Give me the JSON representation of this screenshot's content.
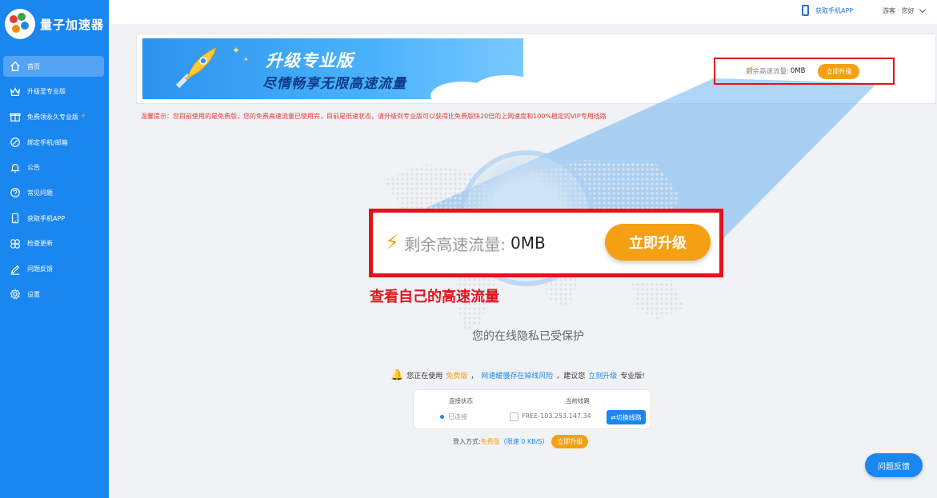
{
  "app": {
    "name": "量子加速器"
  },
  "colors": {
    "sidebar": "#1a86f0",
    "accent_orange": "#f5a012",
    "highlight_red": "#e5121b"
  },
  "sidebar": {
    "items": [
      {
        "label": "首页",
        "icon": "home-icon",
        "active": true
      },
      {
        "label": "升级至专业版",
        "icon": "crown-icon"
      },
      {
        "label": "免费领永久专业版",
        "icon": "gift-icon",
        "badge_icon": "lightning-icon"
      },
      {
        "label": "绑定手机/邮箱",
        "icon": "link-icon"
      },
      {
        "label": "公告",
        "icon": "bell-icon"
      },
      {
        "label": "常见问题",
        "icon": "question-icon"
      },
      {
        "label": "获取手机APP",
        "icon": "phone-icon"
      },
      {
        "label": "检查更新",
        "icon": "update-icon"
      },
      {
        "label": "问题反馈",
        "icon": "edit-icon"
      },
      {
        "label": "设置",
        "icon": "gear-icon"
      }
    ]
  },
  "topbar": {
    "get_app": "获取手机APP",
    "user": "游客 · 您好"
  },
  "banner": {
    "line1": "升级专业版",
    "line2": "尽情畅享无限高速流量"
  },
  "traffic": {
    "label": "剩余高速流量:",
    "value": "0MB",
    "upgrade": "立即升级"
  },
  "notice": "温馨提示：您目前使用的是免费版，您的免费高速流量已使用完，目前是低速状态，请升级到专业版可以获得比免费版快20倍的上网速度和100%稳定的VIP专用线路",
  "callout": {
    "label": "剩余高速流量:",
    "value": "0MB",
    "button": "立即升级",
    "caption": "查看自己的高速流量"
  },
  "protected_text": "您的在线隐私已受保护",
  "status_line": {
    "p1": "您正在使用",
    "free": "免费版",
    "p2": "，",
    "risk": "网速缓慢存在掉线风险",
    "p3": "，建议您",
    "upgrade_now": "立刻升级",
    "p4": "专业版!"
  },
  "connection": {
    "status_header": "连接状态",
    "status_value": "已连接",
    "route_header": "当前线路",
    "route_value": "FREE-103.253.147.34",
    "switch_button": "⇌切换线路"
  },
  "login": {
    "prefix": "登入方式:",
    "mode": "免费版",
    "limit_open": "（",
    "limit": "限速 0 KB/S",
    "limit_close": "）",
    "upgrade": "立即升级"
  },
  "feedback_button": "问题反馈"
}
